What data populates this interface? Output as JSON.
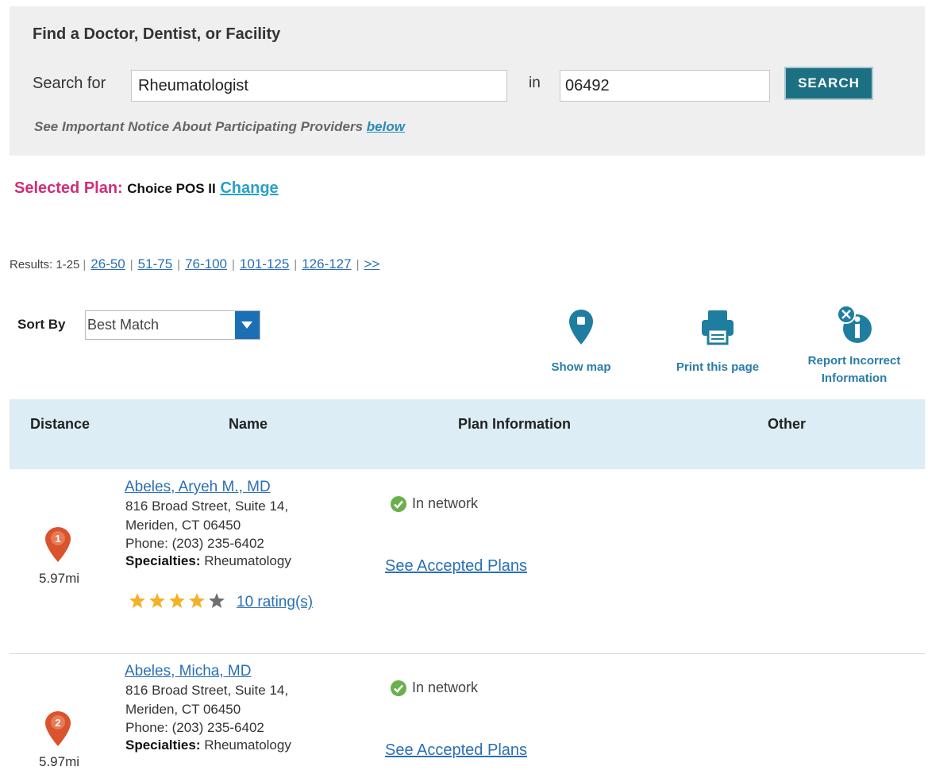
{
  "search": {
    "title": "Find a Doctor, Dentist, or Facility",
    "search_for_label": "Search for",
    "query_value": "Rheumatologist",
    "in_label": "in",
    "location_value": "06492",
    "button_label": "SEARCH",
    "notice_text": "See Important Notice About Participating Providers ",
    "notice_link": "below"
  },
  "plan": {
    "label": "Selected Plan:",
    "name": "Choice POS II",
    "change_link": "Change"
  },
  "pagination": {
    "label": "Results: 1-25",
    "pages": [
      "26-50",
      "51-75",
      "76-100",
      "101-125",
      "126-127",
      ">>"
    ]
  },
  "sort": {
    "label": "Sort By",
    "selected": "Best Match"
  },
  "tools": {
    "show_map": "Show map",
    "print_page": "Print this page",
    "report_line1": "Report Incorrect",
    "report_line2": "Information"
  },
  "colors": {
    "accent_teal": "#1d6f83",
    "plan_pink": "#cf2e7a",
    "link_blue": "#2a6fb5",
    "header_bg": "#dcedf5",
    "pin_orange": "#d9532c",
    "star_gold": "#f5b027",
    "check_green": "#6ab04c"
  },
  "table": {
    "columns": [
      "Distance",
      "Name",
      "Plan Information",
      "Other"
    ]
  },
  "results": [
    {
      "index": "1",
      "distance": "5.97mi",
      "name": "Abeles, Aryeh M., MD",
      "address1": "816 Broad Street, Suite 14,",
      "address2": "Meriden, CT 06450",
      "phone": "Phone: (203) 235-6402",
      "specialties_label": "Specialties:",
      "specialties": " Rheumatology",
      "network": "In network",
      "accepted_plans": "See Accepted Plans",
      "rating_stars": 4,
      "rating_max": 5,
      "ratings_text": "10 rating(s)"
    },
    {
      "index": "2",
      "distance": "5.97mi",
      "name": "Abeles, Micha, MD",
      "address1": "816 Broad Street, Suite 14,",
      "address2": "Meriden, CT 06450",
      "phone": "Phone: (203) 235-6402",
      "specialties_label": "Specialties:",
      "specialties": " Rheumatology",
      "network": "In network",
      "accepted_plans": "See Accepted Plans"
    }
  ]
}
